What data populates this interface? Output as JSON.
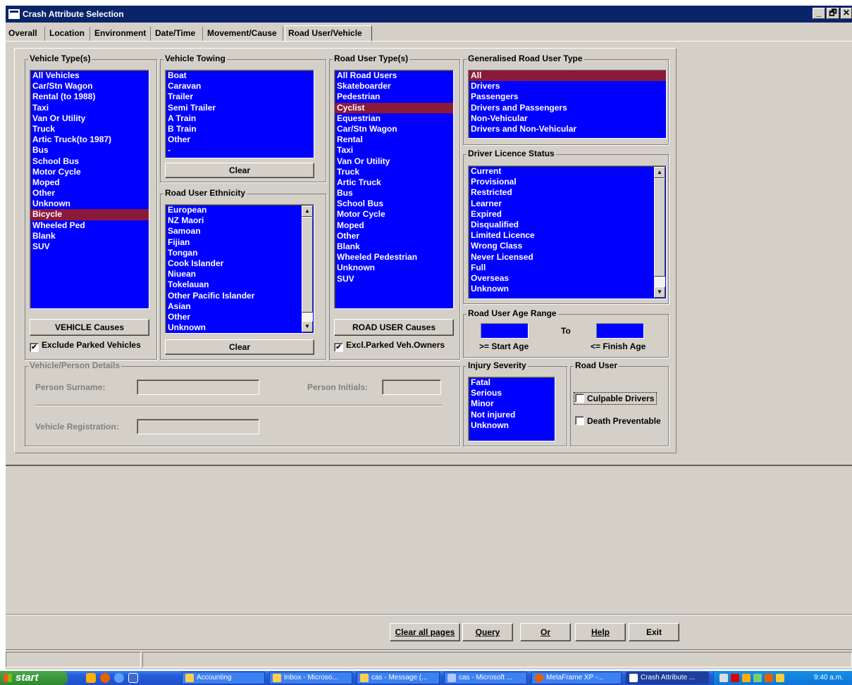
{
  "window": {
    "title": "Crash Attribute Selection",
    "min": "_",
    "max": "🗗",
    "close": "✕"
  },
  "tabs": [
    "Overall",
    "Location",
    "Environment",
    "Date/Time",
    "Movement/Cause",
    "Road User/Vehicle"
  ],
  "vehicle_types": {
    "label": "Vehicle Type(s)",
    "items": [
      "All Vehicles",
      "Car/Stn Wagon",
      "Rental (to 1988)",
      "Taxi",
      "Van Or Utility",
      "Truck",
      "Artic Truck(to 1987)",
      "Bus",
      "School Bus",
      "Motor Cycle",
      "Moped",
      "Other",
      "Unknown",
      "Bicycle",
      "Wheeled Ped",
      "Blank",
      "SUV"
    ],
    "selected": "Bicycle",
    "causes_button": "VEHICLE Causes",
    "exclude_parked": "Exclude Parked Vehicles",
    "exclude_checked": true
  },
  "vehicle_towing": {
    "label": "Vehicle Towing",
    "items": [
      "Boat",
      "Caravan",
      "Trailer",
      "Semi Trailer",
      "A Train",
      "B Train",
      "Other",
      "-"
    ],
    "clear": "Clear"
  },
  "ethnicity": {
    "label": "Road User Ethnicity",
    "items": [
      "European",
      "NZ Maori",
      "Samoan",
      "Fijian",
      "Tongan",
      "Cook Islander",
      "Niuean",
      "Tokelauan",
      "Other Pacific Islander",
      "Asian",
      "Other",
      "Unknown"
    ],
    "clear": "Clear"
  },
  "road_user_types": {
    "label": "Road User Type(s)",
    "items": [
      "All Road Users",
      "Skateboarder",
      "Pedestrian",
      "Cyclist",
      "Equestrian",
      "Car/Stn Wagon",
      "Rental",
      "Taxi",
      "Van Or Utility",
      "Truck",
      "Artic Truck",
      "Bus",
      "School Bus",
      "Motor Cycle",
      "Moped",
      "Other",
      "Blank",
      "Wheeled Pedestrian",
      "Unknown",
      "SUV"
    ],
    "selected": "Cyclist",
    "causes_button": "ROAD USER Causes",
    "exclude_parked": "Excl.Parked Veh.Owners",
    "exclude_checked": true
  },
  "generalised": {
    "label": "Generalised Road User Type",
    "items": [
      "All",
      "Drivers",
      "Passengers",
      "Drivers and Passengers",
      "Non-Vehicular",
      "Drivers and Non-Vehicular"
    ],
    "selected": "All"
  },
  "licence": {
    "label": "Driver Licence Status",
    "items": [
      "Current",
      "Provisional",
      "Restricted",
      "Learner",
      "Expired",
      "Disqualified",
      "Limited Licence",
      "Wrong Class",
      "Never Licensed",
      "Full",
      "Overseas",
      "Unknown"
    ]
  },
  "age_range": {
    "label": "Road User Age Range",
    "to": "To",
    "start": ">= Start Age",
    "finish": "<= Finish Age"
  },
  "details": {
    "label": "Vehicle/Person Details",
    "surname": "Person Surname:",
    "initials": "Person Initials:",
    "registration": "Vehicle Registration:"
  },
  "injury": {
    "label": "Injury Severity",
    "items": [
      "Fatal",
      "Serious",
      "Minor",
      "Not injured",
      "Unknown"
    ]
  },
  "road_user": {
    "label": "Road User",
    "culpable": "Culpable Drivers",
    "death": "Death Preventable"
  },
  "buttons": {
    "clear_all": "Clear all pages",
    "query": "Query",
    "or": "Or",
    "help": "Help",
    "exit": "Exit"
  },
  "check_mark": "✔",
  "scroll": {
    "up": "▲",
    "down": "▼"
  },
  "taskbar": {
    "start": "start",
    "items": [
      "Accounting",
      "Inbox - Microso...",
      "cas - Message (...",
      "cas - Microsoft ...",
      "MetaFrame XP -...",
      "Crash Attribute ..."
    ],
    "clock": "9:40 a.m."
  }
}
